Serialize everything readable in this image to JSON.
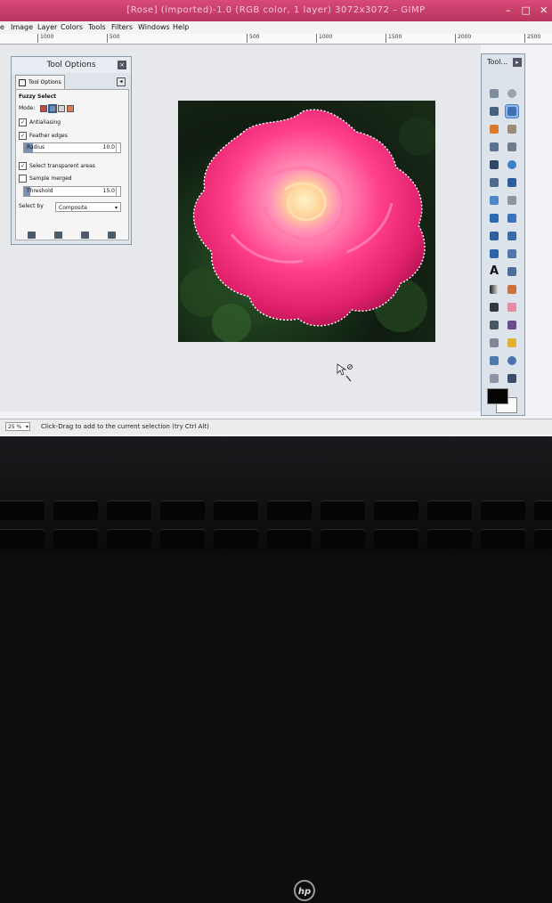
{
  "window": {
    "title": "[Rose] (imported)-1.0 (RGB color, 1 layer) 3072x3072 – GIMP"
  },
  "menubar": {
    "items": [
      "e",
      "Image",
      "Layer",
      "Colors",
      "Tools",
      "Filters",
      "Windows",
      "Help"
    ]
  },
  "ruler": {
    "ticks": [
      "1000",
      "500",
      "500",
      "1000",
      "1500",
      "2000",
      "2500"
    ]
  },
  "tool_options": {
    "title": "Tool Options",
    "tab_label": "Tool Options",
    "tool_name": "Fuzzy Select",
    "mode_label": "Mode:",
    "antialiasing": {
      "label": "Antialiasing",
      "checked": true
    },
    "feather_edges": {
      "label": "Feather edges",
      "checked": true
    },
    "radius": {
      "label": "Radius",
      "value": "10.0",
      "fill": 0.09
    },
    "select_transparent": {
      "label": "Select transparent areas",
      "checked": true
    },
    "sample_merged": {
      "label": "Sample merged",
      "checked": false
    },
    "threshold": {
      "label": "Threshold",
      "value": "15.0",
      "fill": 0.06
    },
    "select_by": {
      "label": "Select by",
      "value": "Composite"
    }
  },
  "toolbox": {
    "title": "Tool..."
  },
  "statusbar": {
    "zoom": "25 %",
    "message": "Click-Drag to add to the current selection (try Ctrl Alt)"
  },
  "bezel": {
    "logo": "hp"
  },
  "colors": {
    "titlebar": "#c63d68",
    "active_tool": "#8fb6e8",
    "foreground": "#050505",
    "background": "#fafafa"
  }
}
